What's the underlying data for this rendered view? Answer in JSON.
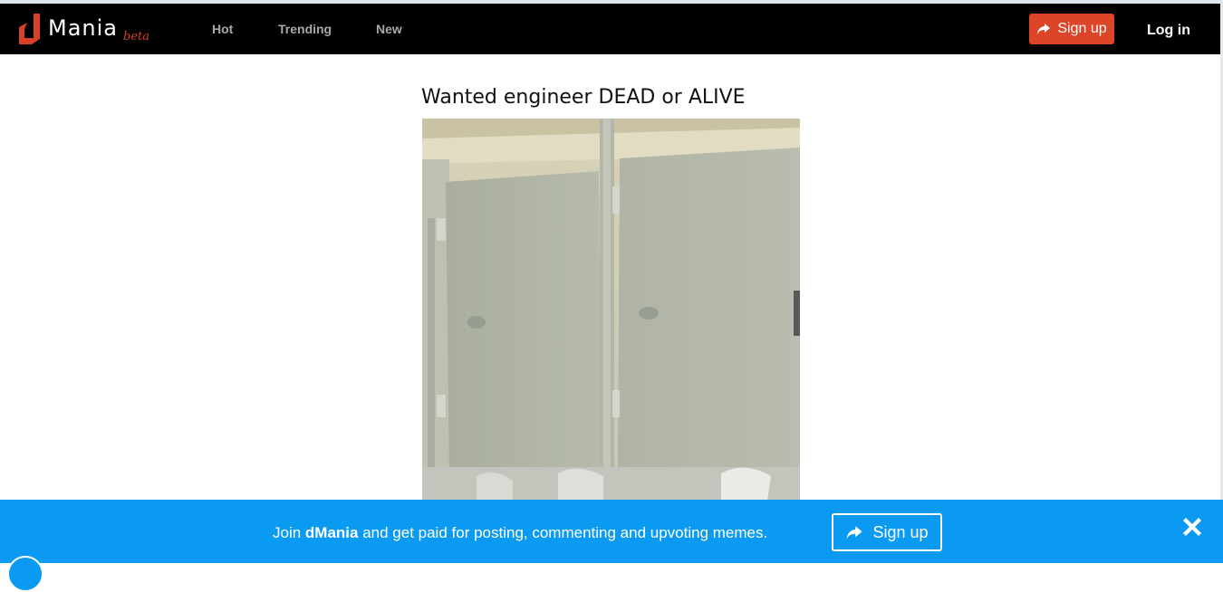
{
  "nav": {
    "logo_text": "Mania",
    "logo_badge": "beta",
    "links": [
      "Hot",
      "Trending",
      "New"
    ],
    "signup_label": "Sign up",
    "login_label": "Log in"
  },
  "post": {
    "title": "Wanted engineer DEAD or ALIVE",
    "image_icon": "meme-image-bathroom-stalls"
  },
  "banner": {
    "text_before": "Join ",
    "brand": "dMania",
    "text_after": " and get paid for posting, commenting and upvoting memes.",
    "signup_label": "Sign up",
    "close_icon": "close-icon"
  },
  "colors": {
    "nav_bg": "#000000",
    "accent": "#dc4528",
    "banner_bg": "#0a9af2"
  }
}
